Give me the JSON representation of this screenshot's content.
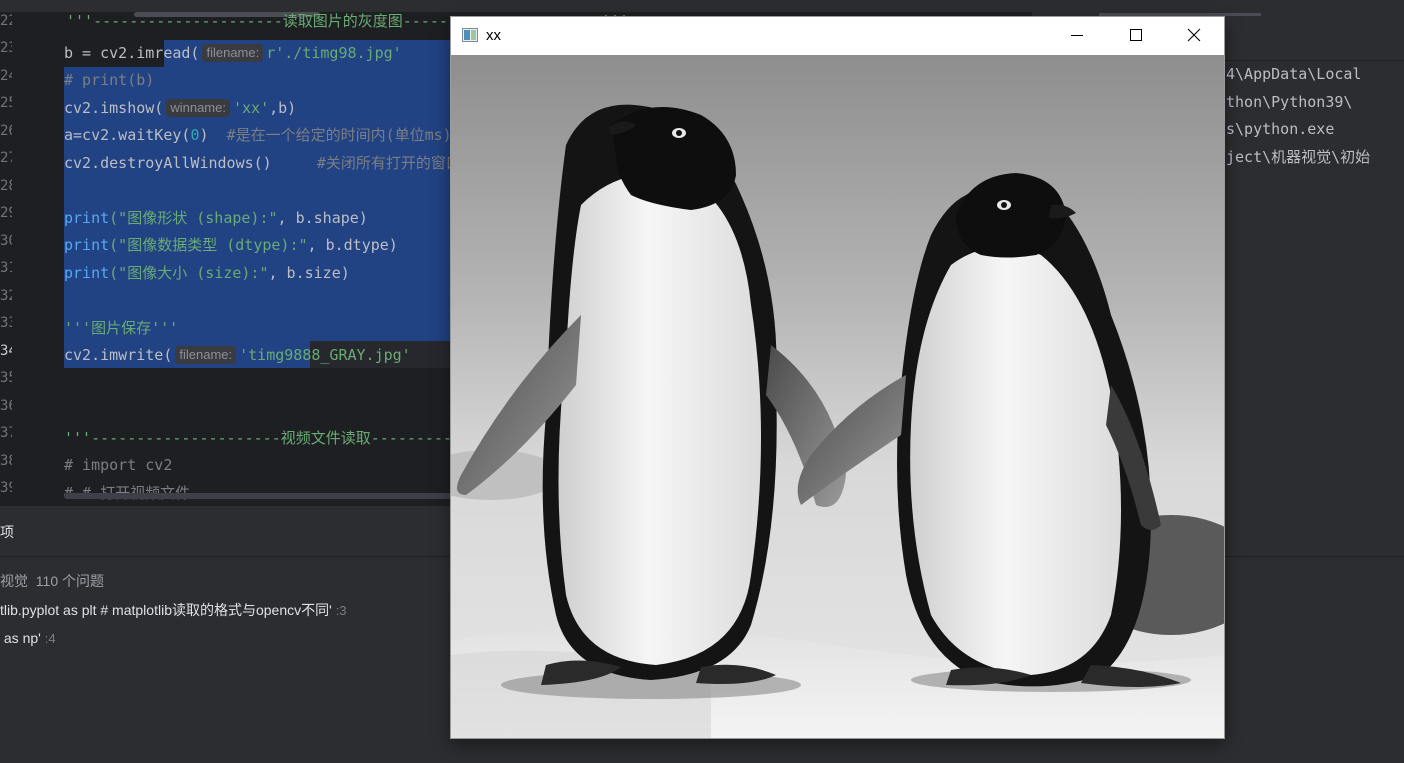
{
  "editor": {
    "line_numbers": [
      "22",
      "23",
      "24",
      "25",
      "26",
      "27",
      "28",
      "29",
      "30",
      "31",
      "32",
      "33",
      "34",
      "35",
      "36",
      "37",
      "38",
      "39"
    ],
    "current_line": "34",
    "lines": {
      "l22_code": "'''---------------------读取图片的灰度图----------------------'''",
      "l23_a": "b = cv2.imread(",
      "l23_hint": "filename:",
      "l23_str": "r'./timg98.jpg'",
      "l24": "# print(b)",
      "l25_a": "cv2.imshow(",
      "l25_hint": "winname:",
      "l25_str": "'xx'",
      "l25_b": ",b)",
      "l26_a": "a=cv2.waitKey(",
      "l26_num": "0",
      "l26_b": ")  ",
      "l26_cmt": "#是在一个给定的时间内(单位ms)等待用户按键触发",
      "l27_a": "cv2.destroyAllWindows()     ",
      "l27_cmt": "#关闭所有打开的窗口",
      "l29_fn": "print",
      "l29_str": "(\"图像形状 (shape):\"",
      "l29_b": ", b.shape)",
      "l30_fn": "print",
      "l30_str": "(\"图像数据类型 (dtype):\"",
      "l30_b": ", b.dtype)",
      "l31_fn": "print",
      "l31_str": "(\"图像大小 (size):\"",
      "l31_b": ", b.size)",
      "l33": "'''图片保存'''",
      "l34_a": "cv2.imwrite(",
      "l34_hint": "filename:",
      "l34_str": "'timg9888_GRAY.jpg'",
      "l37": "'''---------------------视频文件读取----------------------'''",
      "l38": "# import cv2",
      "l39": "# # 打开视频文件"
    }
  },
  "run_output": {
    "lines": [
      "4\\AppData\\Local",
      "thon\\Python39\\",
      "s\\python.exe",
      "ject\\机器视觉\\初始"
    ]
  },
  "problems": {
    "title": "项",
    "file": "视觉",
    "count": "110 个问题",
    "items": [
      {
        "text": "tlib.pyplot as plt # matplotlib读取的格式与opencv不同'",
        "line": ":3"
      },
      {
        "text": " as np'",
        "line": ":4"
      }
    ]
  },
  "window": {
    "title": "xx",
    "buttons": [
      "minimize",
      "maximize",
      "close"
    ],
    "content": "grayscale photo of two penguins standing on snow"
  },
  "colors": {
    "editor_bg": "#1e1f22",
    "panel_bg": "#2b2d30",
    "selection": "#214283",
    "string": "#6aab73",
    "comment": "#7a7e85",
    "number": "#2aacb8",
    "function": "#56a8f5"
  }
}
